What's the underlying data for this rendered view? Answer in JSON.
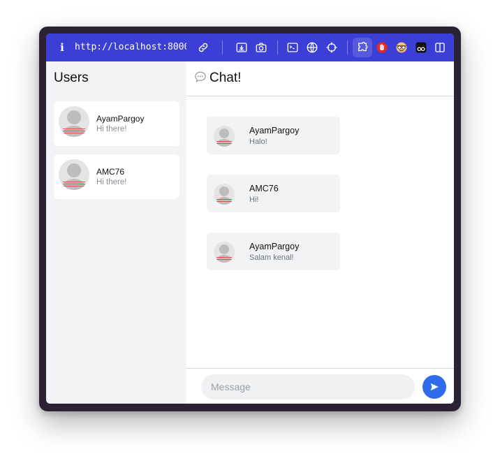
{
  "browser": {
    "info_glyph": "i",
    "url": "http://localhost:8000/c...",
    "accent": "#3b3fd6",
    "toolbar_icons": [
      "link-icon",
      "download-icon",
      "camera-icon",
      "terminal-icon",
      "globe-icon",
      "crosshair-icon",
      "extensions-icon",
      "stop-hand-icon",
      "disguise-icon",
      "viewer-icon",
      "split-view-icon"
    ]
  },
  "sidebar": {
    "title": "Users",
    "users": [
      {
        "name": "AyamPargoy",
        "last_message": "Hi there!"
      },
      {
        "name": "AMC76",
        "last_message": "Hi there!"
      }
    ]
  },
  "chat": {
    "icon": "speech-bubble-icon",
    "title": "Chat!",
    "messages": [
      {
        "name": "AyamPargoy",
        "text": "Halo!"
      },
      {
        "name": "AMC76",
        "text": "Hi!"
      },
      {
        "name": "AyamPargoy",
        "text": "Salam kenal!"
      }
    ],
    "composer": {
      "placeholder": "Message",
      "value": "",
      "send_color": "#2f6bea"
    }
  }
}
